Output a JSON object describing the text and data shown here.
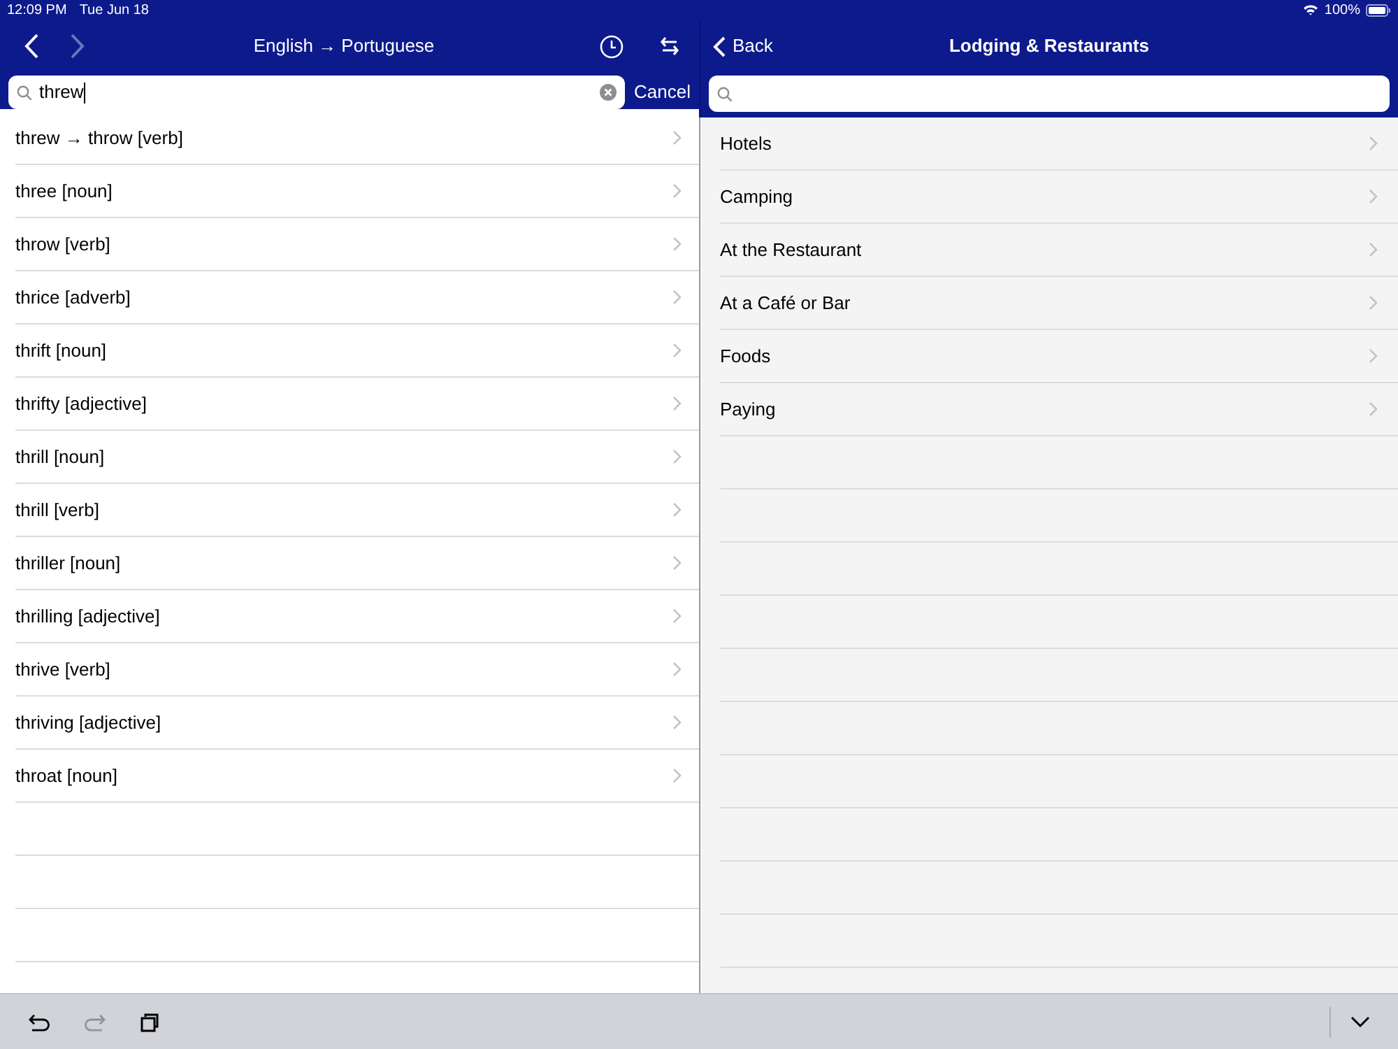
{
  "status_bar": {
    "time": "12:09 PM",
    "date": "Tue Jun 18",
    "battery": "100%"
  },
  "left_pane": {
    "title": "English → Portuguese",
    "back_disabled": false,
    "forward_disabled": true,
    "search": {
      "value": "threw",
      "cancel": "Cancel"
    },
    "results": [
      {
        "label": "threw → throw [verb]"
      },
      {
        "label": "three [noun]"
      },
      {
        "label": "throw [verb]"
      },
      {
        "label": "thrice [adverb]"
      },
      {
        "label": "thrift [noun]"
      },
      {
        "label": "thrifty [adjective]"
      },
      {
        "label": "thrill [noun]"
      },
      {
        "label": "thrill [verb]"
      },
      {
        "label": "thriller [noun]"
      },
      {
        "label": "thrilling [adjective]"
      },
      {
        "label": "thrive [verb]"
      },
      {
        "label": "thriving [adjective]"
      },
      {
        "label": "throat [noun]"
      }
    ]
  },
  "right_pane": {
    "back": "Back",
    "title": "Lodging & Restaurants",
    "items": [
      {
        "label": "Hotels"
      },
      {
        "label": "Camping"
      },
      {
        "label": "At the Restaurant"
      },
      {
        "label": "At a Café or Bar"
      },
      {
        "label": "Foods"
      },
      {
        "label": "Paying"
      }
    ]
  },
  "toolbar": {
    "undo_disabled": false,
    "redo_disabled": true
  }
}
